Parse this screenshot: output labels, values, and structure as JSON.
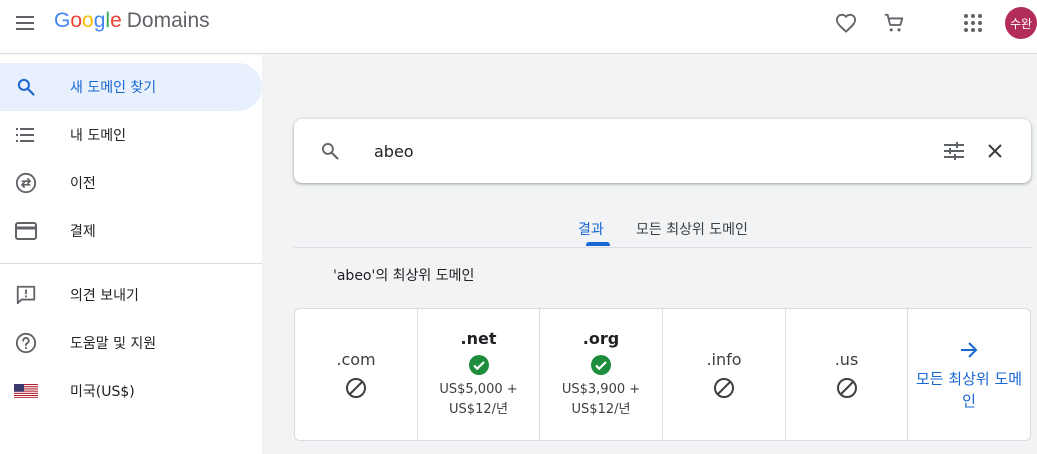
{
  "header": {
    "logo": {
      "g1": "G",
      "o1": "o",
      "o2": "o",
      "g2": "g",
      "l": "l",
      "e": "e",
      "product": "Domains"
    },
    "avatar_text": "수완",
    "icons": [
      "menu-icon",
      "heart-icon",
      "cart-icon",
      "apps-icon"
    ]
  },
  "sidebar": {
    "items": [
      {
        "label": "새 도메인 찾기",
        "icon": "search-icon",
        "active": true
      },
      {
        "label": "내 도메인",
        "icon": "list-icon"
      },
      {
        "label": "이전",
        "icon": "transfer-icon"
      },
      {
        "label": "결제",
        "icon": "credit-card-icon"
      },
      {
        "label": "의견 보내기",
        "icon": "feedback-icon"
      },
      {
        "label": "도움말 및 지원",
        "icon": "help-icon"
      },
      {
        "label": "미국(US$)",
        "icon": "us-flag-icon"
      }
    ]
  },
  "search": {
    "value": "abeo"
  },
  "tabs": [
    {
      "label": "결과",
      "active": true
    },
    {
      "label": "모든 최상위 도메인"
    }
  ],
  "section_title": "'abeo'의 최상위 도메인",
  "tlds": [
    {
      "name": ".com",
      "status": "unavailable"
    },
    {
      "name": ".net",
      "status": "available",
      "price_line1": "US$5,000 +",
      "price_line2": "US$12/년"
    },
    {
      "name": ".org",
      "status": "available",
      "price_line1": "US$3,900 +",
      "price_line2": "US$12/년"
    },
    {
      "name": ".info",
      "status": "unavailable"
    },
    {
      "name": ".us",
      "status": "unavailable"
    }
  ],
  "more_tlds_label": "모든 최상위 도메인",
  "colors": {
    "accent": "#1967d2",
    "available": "#1e8e3e",
    "avatar": "#b22d5a",
    "active_bg": "#e8f0fe"
  }
}
